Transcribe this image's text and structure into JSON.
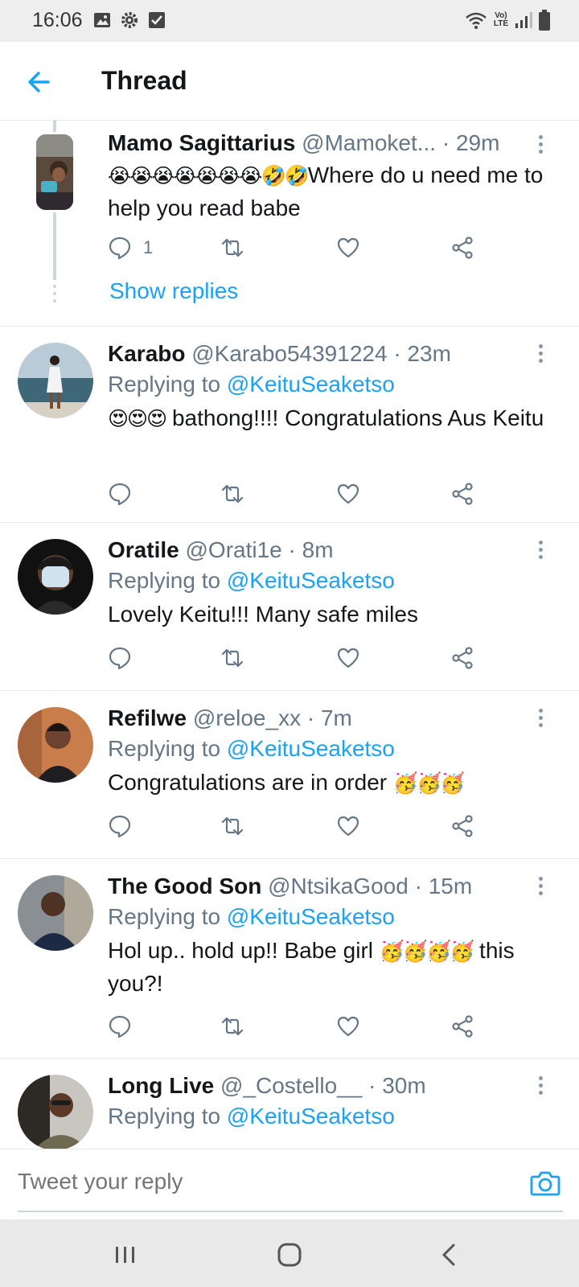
{
  "status_bar": {
    "time": "16:06",
    "left_icons": [
      "gallery-icon",
      "settings-icon",
      "check-box-icon"
    ],
    "right_icons": [
      "wifi-icon",
      "volte-icon",
      "signal-icon",
      "battery-icon"
    ],
    "volte_top": "Vo)",
    "volte_bottom": "LTE"
  },
  "header": {
    "title": "Thread",
    "back_icon": "arrow-left-icon"
  },
  "colors": {
    "accent": "#1da1f2",
    "text": "#14171a",
    "secondary": "#657786",
    "border": "#e1e8ed"
  },
  "tweets": [
    {
      "name": "Mamo Sagittarius",
      "handle": "@Mamoket...",
      "time": "· 29m",
      "emoji_prefix": "😭😭😭😭😭😭😭🤣🤣",
      "text": "Where do u  need me to help you read babe",
      "reply_count": "1",
      "show_replies": "Show replies"
    },
    {
      "name": "Karabo",
      "handle": "@Karabo54391224",
      "time": "· 23m",
      "replying_label": "Replying to",
      "replying_handle": "@KeituSeaketso",
      "emoji_prefix": "😍😍😍",
      "text": " bathong!!!! Congratulations Aus Keitu"
    },
    {
      "name": "Oratile",
      "handle": "@Orati1e",
      "time": "· 8m",
      "replying_label": "Replying to",
      "replying_handle": "@KeituSeaketso",
      "text": "Lovely Keitu!!! Many safe miles"
    },
    {
      "name": "Refilwe",
      "handle": "@reloe_xx",
      "time": "· 7m",
      "replying_label": "Replying to",
      "replying_handle": "@KeituSeaketso",
      "text": "Congratulations are in order ",
      "emoji_suffix": "🥳🥳🥳"
    },
    {
      "name": "The Good Son",
      "handle": "@NtsikaGood",
      "time": "· 15m",
      "replying_label": "Replying to",
      "replying_handle": "@KeituSeaketso",
      "text": "Hol up.. hold up!! Babe girl ",
      "emoji_mid": "🥳🥳🥳🥳",
      "text_after": " this you?!"
    },
    {
      "name": "Long Live",
      "handle": "@_Costello__",
      "time": "· 30m",
      "replying_label": "Replying to",
      "replying_handle": "@KeituSeaketso"
    }
  ],
  "reply_bar": {
    "placeholder": "Tweet your reply",
    "camera_icon": "camera-icon"
  },
  "nav_bar": {
    "buttons": [
      "recent-apps-icon",
      "home-icon",
      "back-icon"
    ]
  }
}
